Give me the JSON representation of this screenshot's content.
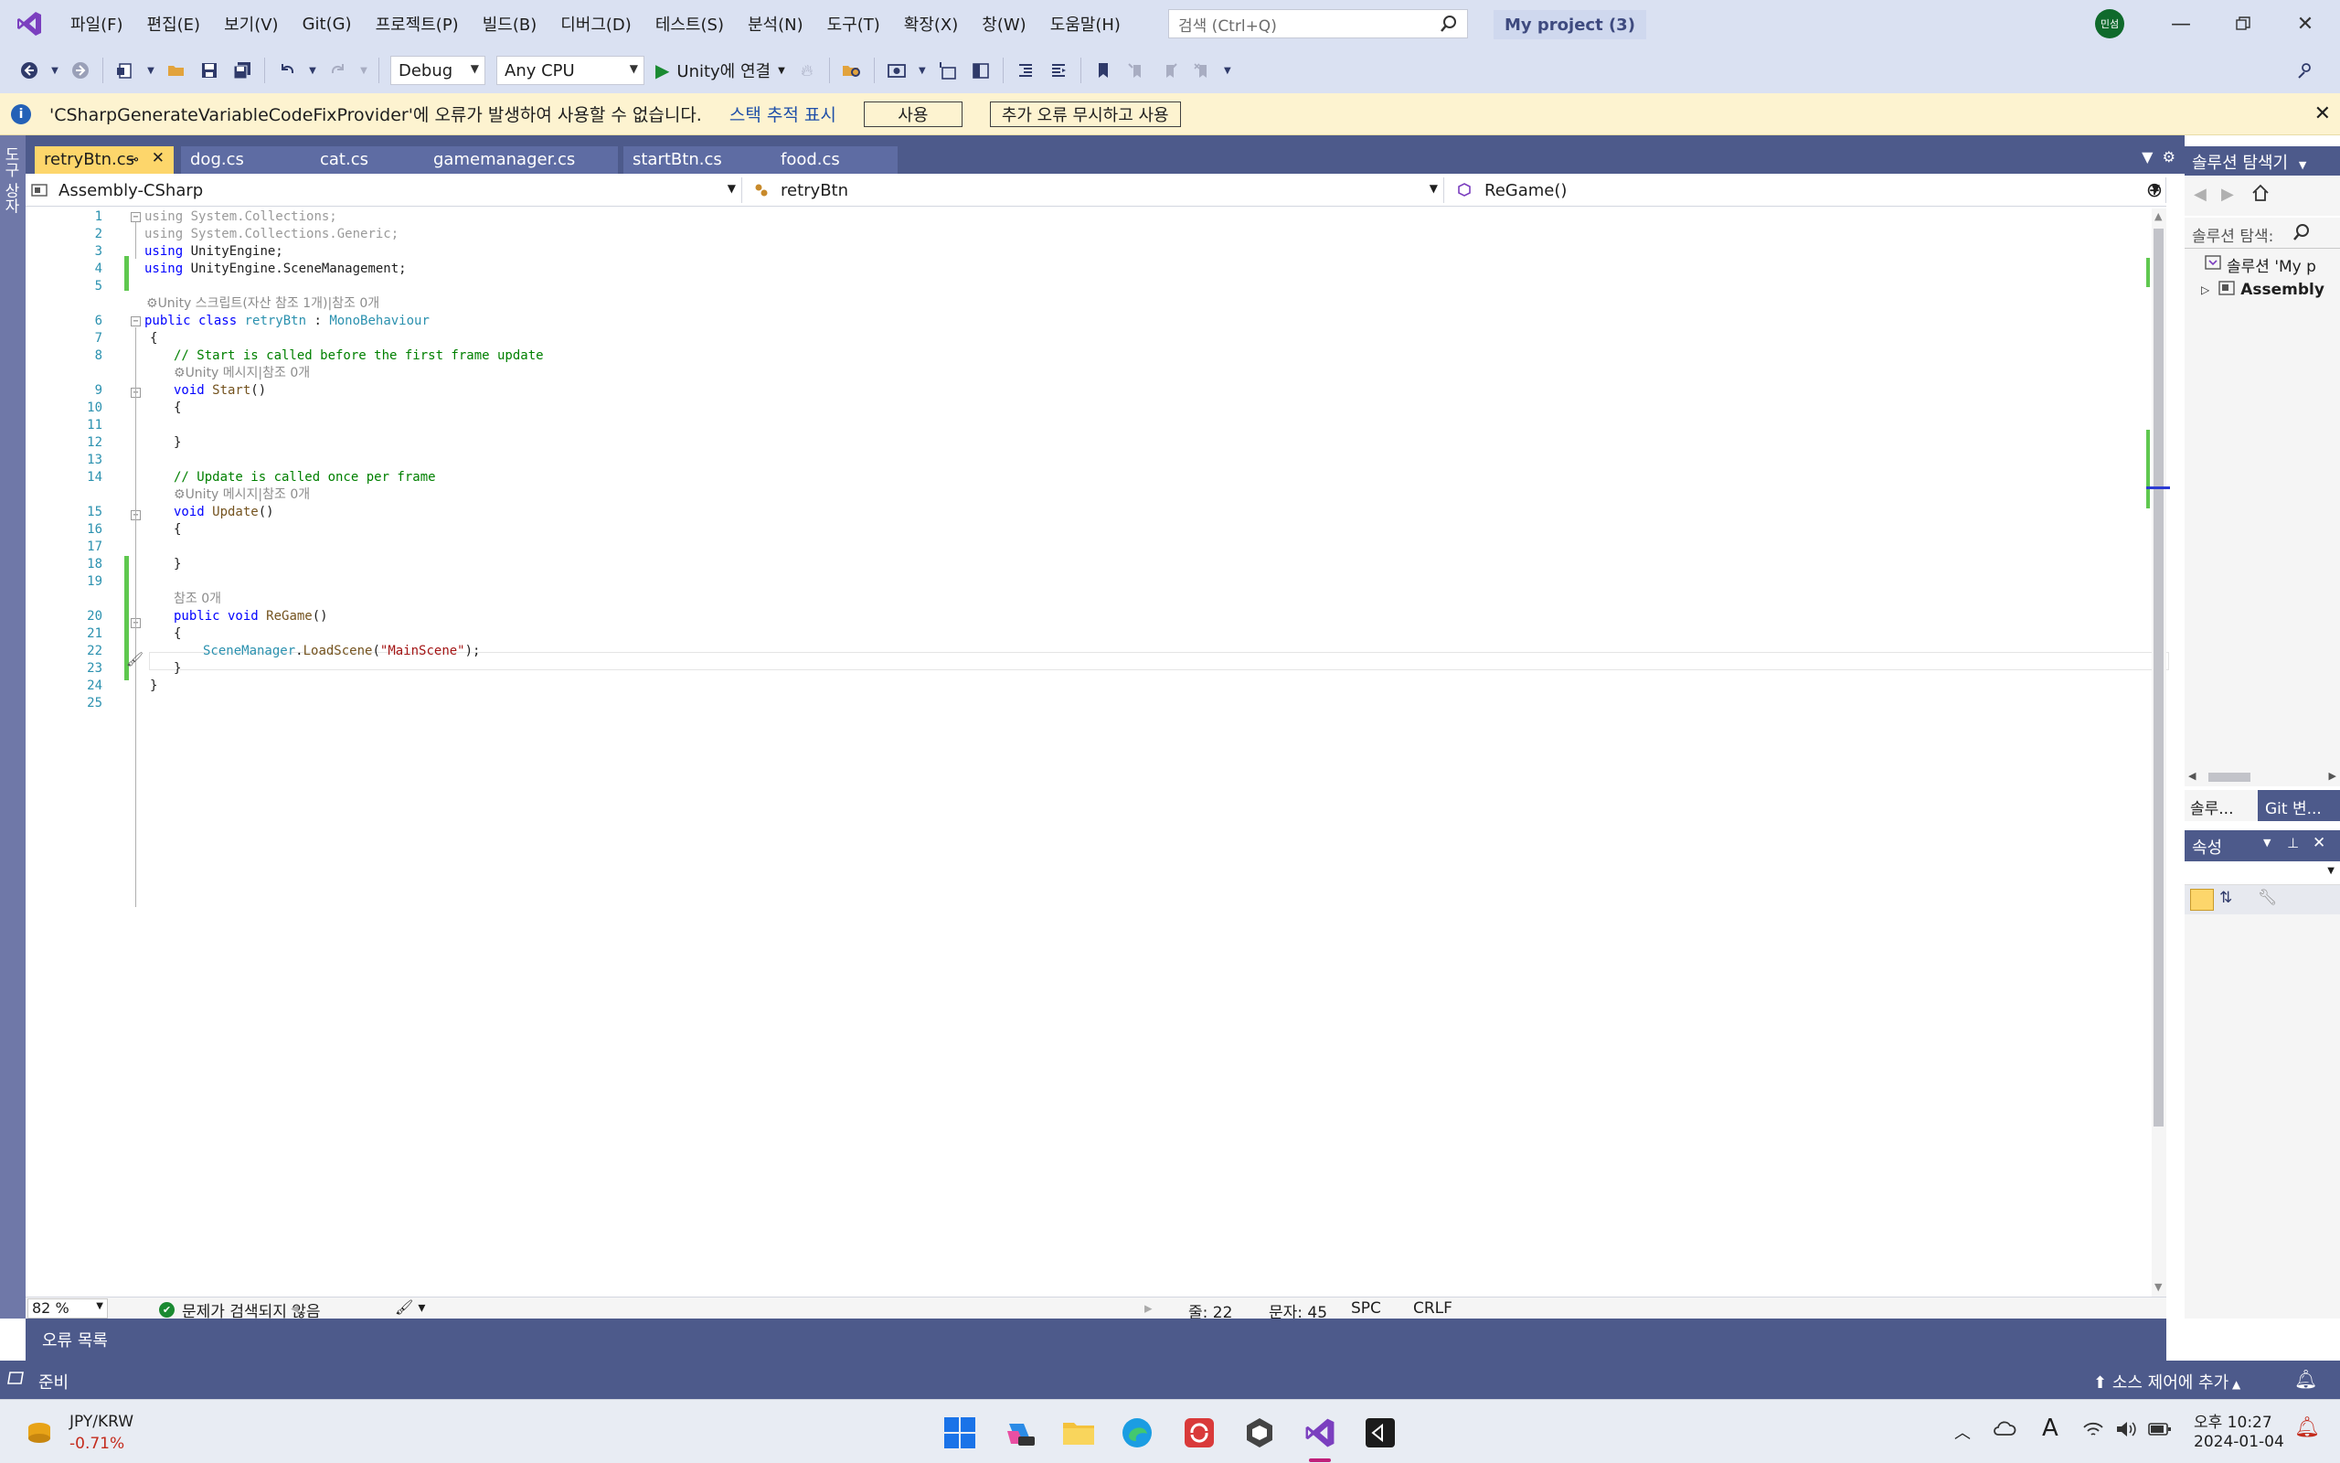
{
  "app": {
    "project_title": "My project (3)",
    "user_initials": "민섬"
  },
  "menu": [
    "파일(F)",
    "편집(E)",
    "보기(V)",
    "Git(G)",
    "프로젝트(P)",
    "빌드(B)",
    "디버그(D)",
    "테스트(S)",
    "분석(N)",
    "도구(T)",
    "확장(X)",
    "창(W)",
    "도움말(H)"
  ],
  "search": {
    "placeholder": "검색 (Ctrl+Q)"
  },
  "toolbar": {
    "config": "Debug",
    "platform": "Any CPU",
    "run_label": "Unity에 연결"
  },
  "infobar": {
    "message": "'CSharpGenerateVariableCodeFixProvider'에 오류가 발생하여 사용할 수 없습니다.",
    "link": "스택 추적 표시",
    "enable_button": "사용",
    "ignore_button": "추가 오류 무시하고 사용"
  },
  "toolbox_label": "도구 상자",
  "tabs": [
    "retryBtn.cs",
    "dog.cs",
    "cat.cs",
    "gamemanager.cs",
    "startBtn.cs",
    "food.cs"
  ],
  "navbar": {
    "project": "Assembly-CSharp",
    "type": "retryBtn",
    "member": "ReGame()"
  },
  "code": {
    "line_numbers": [
      "1",
      "2",
      "3",
      "4",
      "5",
      "6",
      "7",
      "8",
      "9",
      "10",
      "11",
      "12",
      "13",
      "14",
      "15",
      "16",
      "17",
      "18",
      "19",
      "20",
      "21",
      "22",
      "23",
      "24",
      "25"
    ],
    "l1_kw": "using",
    "l1_rest": " System.Collections;",
    "l2_kw": "using",
    "l2_rest": " System.Collections.Generic;",
    "l3_kw": "using",
    "l3_rest": " UnityEngine;",
    "l4_kw": "using",
    "l4_rest": " UnityEngine.SceneManagement;",
    "lens_class": "Unity 스크립트(자산 참조 1개)|참조 0개",
    "l6_public": "public",
    "l6_class": " class ",
    "l6_name": "retryBtn",
    "l6_colon": " : ",
    "l6_base": "MonoBehaviour",
    "l7": "{",
    "l8": "// Start is called before the first frame update",
    "lens_start": "Unity 메시지|참조 0개",
    "l9_void": "void",
    "l9_name": " Start",
    "l9_paren": "()",
    "l10": "{",
    "l12": "}",
    "l14": "// Update is called once per frame",
    "lens_update": "Unity 메시지|참조 0개",
    "l15_void": "void",
    "l15_name": " Update",
    "l15_paren": "()",
    "l16": "{",
    "l18": "}",
    "lens_regame": "참조 0개",
    "l20_public": "public",
    "l20_void": " void ",
    "l20_name": "ReGame",
    "l20_paren": "()",
    "l21": "{",
    "l22_type": "SceneManager",
    "l22_dot": ".",
    "l22_method": "LoadScene",
    "l22_open": "(",
    "l22_str": "\"MainScene\"",
    "l22_close": ");",
    "l23": "}",
    "l24": "}"
  },
  "editor_status": {
    "zoom": "82 %",
    "issues": "문제가 검색되지 않음",
    "line": "줄: 22",
    "col": "문자: 45",
    "spc": "SPC",
    "eol": "CRLF"
  },
  "bottom_panel": {
    "tab": "오류 목록"
  },
  "solution_explorer": {
    "title": "솔루션 탐색기",
    "search_placeholder": "솔루션 탐색:",
    "solution_node": "솔루션 'My p",
    "assembly_node": "Assembly",
    "tab_solution": "솔루...",
    "tab_git": "Git 변..."
  },
  "properties": {
    "title": "속성"
  },
  "statusbar": {
    "ready": "준비",
    "source_control": "소스 제어에 추가"
  },
  "taskbar": {
    "stock_name": "JPY/KRW",
    "stock_change": "-0.71%",
    "time": "오후 10:27",
    "date": "2024-01-04"
  },
  "colors": {
    "accent_blue": "#4d5a8b",
    "chrome": "#dae1f2",
    "active_tab": "#fdd66b",
    "change_green": "#5fc84f"
  }
}
